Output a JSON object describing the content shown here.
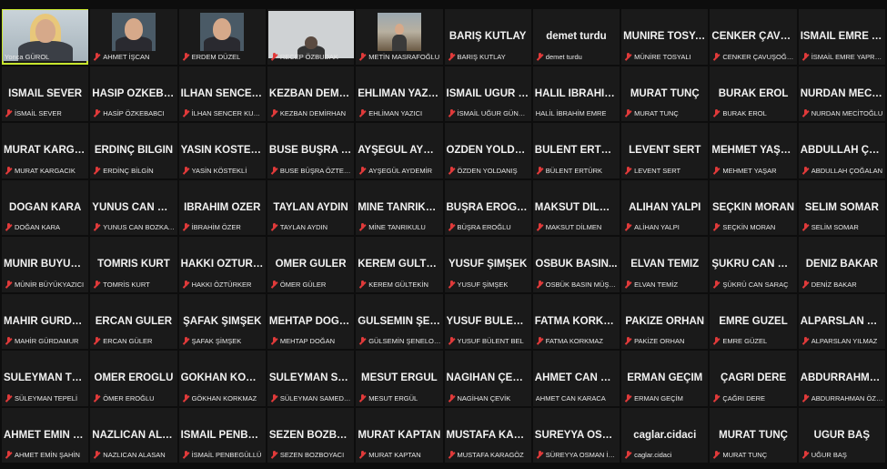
{
  "participants": [
    {
      "big": "",
      "label": "Yonca GÜROL",
      "video": "self",
      "speaking": true,
      "muted": false
    },
    {
      "big": "",
      "label": "AHMET İŞCAN",
      "video": "face",
      "speaking": false,
      "muted": true
    },
    {
      "big": "",
      "label": "ERDEM DÜZEL",
      "video": "face",
      "speaking": false,
      "muted": true
    },
    {
      "big": "",
      "label": "RECEP ÖZBUDAK",
      "video": "wide",
      "speaking": false,
      "muted": true
    },
    {
      "big": "",
      "label": "METİN MASRAFOĞLU",
      "video": "landscape",
      "speaking": false,
      "muted": true
    },
    {
      "big": "BARIŞ KUTLAY",
      "label": "BARIŞ KUTLAY",
      "video": "none",
      "speaking": false,
      "muted": true
    },
    {
      "big": "demet turdu",
      "label": "demet turdu",
      "video": "none",
      "speaking": false,
      "muted": true
    },
    {
      "big": "MÜNİRE TOSYALI",
      "label": "MÜNİRE TOSYALI",
      "video": "none",
      "speaking": false,
      "muted": true
    },
    {
      "big": "CENKER ÇAVUŞ...",
      "label": "CENKER ÇAVUŞOĞLU",
      "video": "none",
      "speaking": false,
      "muted": true
    },
    {
      "big": "İSMAİL EMRE Y...",
      "label": "İSMAİL EMRE YAPRAKCI",
      "video": "none",
      "speaking": false,
      "muted": true
    },
    {
      "big": "İSMAİL SEVER",
      "label": "İSMAİL SEVER",
      "video": "none",
      "speaking": false,
      "muted": true
    },
    {
      "big": "HASİP ÖZKEBA...",
      "label": "HASİP ÖZKEBABCI",
      "video": "none",
      "speaking": false,
      "muted": true
    },
    {
      "big": "İLHAN SENCER...",
      "label": "İLHAN SENCER KURTU...",
      "video": "none",
      "speaking": false,
      "muted": true
    },
    {
      "big": "KEZBAN DEMİR...",
      "label": "KEZBAN DEMİRHAN",
      "video": "none",
      "speaking": false,
      "muted": true
    },
    {
      "big": "EHLİMAN YAZICI",
      "label": "EHLİMAN YAZICI",
      "video": "none",
      "speaking": false,
      "muted": true
    },
    {
      "big": "İSMAİL UĞUR G...",
      "label": "İSMAİL UĞUR GÜNDÜZ",
      "video": "none",
      "speaking": false,
      "muted": true
    },
    {
      "big": "HALİL İBRAHİM...",
      "label": "HALİL İBRAHİM EMRE",
      "video": "none",
      "speaking": false,
      "muted": false
    },
    {
      "big": "MURAT TUNÇ",
      "label": "MURAT TUNÇ",
      "video": "none",
      "speaking": false,
      "muted": true
    },
    {
      "big": "BURAK EROL",
      "label": "BURAK EROL",
      "video": "none",
      "speaking": false,
      "muted": true
    },
    {
      "big": "NURDAN MECİ...",
      "label": "NURDAN MECİTOĞLU",
      "video": "none",
      "speaking": false,
      "muted": true
    },
    {
      "big": "MURAT KARGA...",
      "label": "MURAT KARGACIK",
      "video": "none",
      "speaking": false,
      "muted": true
    },
    {
      "big": "ERDİNÇ BİLGİN",
      "label": "ERDİNÇ BİLGİN",
      "video": "none",
      "speaking": false,
      "muted": true
    },
    {
      "big": "YASİN KÖSTEKLİ",
      "label": "YASİN KÖSTEKLİ",
      "video": "none",
      "speaking": false,
      "muted": true
    },
    {
      "big": "BUSE BÜŞRA Ö...",
      "label": "BUSE BÜŞRA ÖZTEKİN",
      "video": "none",
      "speaking": false,
      "muted": true
    },
    {
      "big": "AYŞEGÜL AYDE...",
      "label": "AYŞEGÜL AYDEMİR",
      "video": "none",
      "speaking": false,
      "muted": true
    },
    {
      "big": "ÖZDEN YOLDA...",
      "label": "ÖZDEN YOLDANIŞ",
      "video": "none",
      "speaking": false,
      "muted": true
    },
    {
      "big": "BÜLENT ERTÜRK",
      "label": "BÜLENT ERTÜRK",
      "video": "none",
      "speaking": false,
      "muted": true
    },
    {
      "big": "LEVENT SERT",
      "label": "LEVENT SERT",
      "video": "none",
      "speaking": false,
      "muted": true
    },
    {
      "big": "MEHMET YAŞAR",
      "label": "MEHMET YAŞAR",
      "video": "none",
      "speaking": false,
      "muted": true
    },
    {
      "big": "ABDULLAH ÇO...",
      "label": "ABDULLAH ÇOĞALAN",
      "video": "none",
      "speaking": false,
      "muted": true
    },
    {
      "big": "DOĞAN KARA",
      "label": "DOĞAN KARA",
      "video": "none",
      "speaking": false,
      "muted": true
    },
    {
      "big": "YUNUS CAN BO...",
      "label": "YUNUS CAN BOZKAYA",
      "video": "none",
      "speaking": false,
      "muted": true
    },
    {
      "big": "İBRAHİM ÖZER",
      "label": "İBRAHİM ÖZER",
      "video": "none",
      "speaking": false,
      "muted": true
    },
    {
      "big": "TAYLAN AYDIN",
      "label": "TAYLAN AYDIN",
      "video": "none",
      "speaking": false,
      "muted": true
    },
    {
      "big": "MİNE TANRIKULU",
      "label": "MİNE TANRIKULU",
      "video": "none",
      "speaking": false,
      "muted": true
    },
    {
      "big": "BÜŞRA EROĞLU",
      "label": "BÜŞRA EROĞLU",
      "video": "none",
      "speaking": false,
      "muted": true
    },
    {
      "big": "MAKSUT DİLMEN",
      "label": "MAKSUT DİLMEN",
      "video": "none",
      "speaking": false,
      "muted": true
    },
    {
      "big": "ALİHAN YALPI",
      "label": "ALİHAN YALPI",
      "video": "none",
      "speaking": false,
      "muted": true
    },
    {
      "big": "SEÇKİN MORAN",
      "label": "SEÇKİN MORAN",
      "video": "none",
      "speaking": false,
      "muted": true
    },
    {
      "big": "SELİM SOMAR",
      "label": "SELİM SOMAR",
      "video": "none",
      "speaking": false,
      "muted": true
    },
    {
      "big": "MÜNİR BÜYÜKY...",
      "label": "MÜNİR BÜYÜKYAZICI",
      "video": "none",
      "speaking": false,
      "muted": true
    },
    {
      "big": "TOMRİS KURT",
      "label": "TOMRİS KURT",
      "video": "none",
      "speaking": false,
      "muted": true
    },
    {
      "big": "HAKKI ÖZTÜRK...",
      "label": "HAKKI ÖZTÜRKER",
      "video": "none",
      "speaking": false,
      "muted": true
    },
    {
      "big": "ÖMER GÜLER",
      "label": "ÖMER GÜLER",
      "video": "none",
      "speaking": false,
      "muted": true
    },
    {
      "big": "KEREM GÜLTEKİN",
      "label": "KEREM GÜLTEKİN",
      "video": "none",
      "speaking": false,
      "muted": true
    },
    {
      "big": "YUSUF ŞİMŞEK",
      "label": "YUSUF ŞİMŞEK",
      "video": "none",
      "speaking": false,
      "muted": true
    },
    {
      "big": "OSBÜK BASIN...",
      "label": "OSBÜK BASIN MÜŞAVİ...",
      "video": "none",
      "speaking": false,
      "muted": true
    },
    {
      "big": "ELVAN TEMİZ",
      "label": "ELVAN TEMİZ",
      "video": "none",
      "speaking": false,
      "muted": true
    },
    {
      "big": "ŞÜKRÜ CAN SA...",
      "label": "ŞÜKRÜ CAN SARAÇ",
      "video": "none",
      "speaking": false,
      "muted": true
    },
    {
      "big": "DENİZ BAKAR",
      "label": "DENİZ BAKAR",
      "video": "none",
      "speaking": false,
      "muted": true
    },
    {
      "big": "MAHİR GÜRDA...",
      "label": "MAHİR GÜRDAMUR",
      "video": "none",
      "speaking": false,
      "muted": true
    },
    {
      "big": "ERCAN GÜLER",
      "label": "ERCAN GÜLER",
      "video": "none",
      "speaking": false,
      "muted": true
    },
    {
      "big": "ŞAFAK ŞİMŞEK",
      "label": "ŞAFAK ŞİMŞEK",
      "video": "none",
      "speaking": false,
      "muted": true
    },
    {
      "big": "MEHTAP DOĞAN",
      "label": "MEHTAP DOĞAN",
      "video": "none",
      "speaking": false,
      "muted": true
    },
    {
      "big": "GÜLSEMİN ŞEN...",
      "label": "GÜLSEMİN ŞENELOĞLU",
      "video": "none",
      "speaking": false,
      "muted": true
    },
    {
      "big": "YUSUF BÜLENT...",
      "label": "YUSUF BÜLENT BEL",
      "video": "none",
      "speaking": false,
      "muted": true
    },
    {
      "big": "FATMA KORKM...",
      "label": "FATMA KORKMAZ",
      "video": "none",
      "speaking": false,
      "muted": true
    },
    {
      "big": "PAKİZE ORHAN",
      "label": "PAKİZE ORHAN",
      "video": "none",
      "speaking": false,
      "muted": true
    },
    {
      "big": "EMRE GÜZEL",
      "label": "EMRE GÜZEL",
      "video": "none",
      "speaking": false,
      "muted": true
    },
    {
      "big": "ALPARSLAN YIL...",
      "label": "ALPARSLAN YILMAZ",
      "video": "none",
      "speaking": false,
      "muted": true
    },
    {
      "big": "SÜLEYMAN TEP...",
      "label": "SÜLEYMAN TEPELİ",
      "video": "none",
      "speaking": false,
      "muted": true
    },
    {
      "big": "ÖMER EROĞLU",
      "label": "ÖMER EROĞLU",
      "video": "none",
      "speaking": false,
      "muted": true
    },
    {
      "big": "GÖKHAN KORK...",
      "label": "GÖKHAN KORKMAZ",
      "video": "none",
      "speaking": false,
      "muted": true
    },
    {
      "big": "SÜLEYMAN SA...",
      "label": "SÜLEYMAN SAMED U...",
      "video": "none",
      "speaking": false,
      "muted": true
    },
    {
      "big": "MESUT ERGÜL",
      "label": "MESUT ERGÜL",
      "video": "none",
      "speaking": false,
      "muted": true
    },
    {
      "big": "NAGİHAN ÇEVİK",
      "label": "NAGİHAN ÇEVİK",
      "video": "none",
      "speaking": false,
      "muted": true
    },
    {
      "big": "AHMET CAN KA...",
      "label": "AHMET CAN KARACA",
      "video": "none",
      "speaking": false,
      "muted": false
    },
    {
      "big": "ERMAN GEÇİM",
      "label": "ERMAN GEÇİM",
      "video": "none",
      "speaking": false,
      "muted": true
    },
    {
      "big": "ÇAĞRI DERE",
      "label": "ÇAĞRI DERE",
      "video": "none",
      "speaking": false,
      "muted": true
    },
    {
      "big": "ABDURRAHMA...",
      "label": "ABDURRAHMAN ÖZK...",
      "video": "none",
      "speaking": false,
      "muted": true
    },
    {
      "big": "AHMET EMİN Ş...",
      "label": "AHMET EMİN ŞAHİN",
      "video": "none",
      "speaking": false,
      "muted": true
    },
    {
      "big": "NAZLICAN ALA...",
      "label": "NAZLICAN ALASAN",
      "video": "none",
      "speaking": false,
      "muted": true
    },
    {
      "big": "İSMAİL PENBEG...",
      "label": "İSMAİL PENBEGÜLLÜ",
      "video": "none",
      "speaking": false,
      "muted": true
    },
    {
      "big": "SEZEN BOZBOY...",
      "label": "SEZEN BOZBOYACI",
      "video": "none",
      "speaking": false,
      "muted": true
    },
    {
      "big": "MURAT KAPTAN",
      "label": "MURAT KAPTAN",
      "video": "none",
      "speaking": false,
      "muted": true
    },
    {
      "big": "MUSTAFA KARA...",
      "label": "MUSTAFA KARAGÖZ",
      "video": "none",
      "speaking": false,
      "muted": true
    },
    {
      "big": "SÜREYYA OSMA...",
      "label": "SÜREYYA OSMAN İNA...",
      "video": "none",
      "speaking": false,
      "muted": true
    },
    {
      "big": "caglar.cidaci",
      "label": "caglar.cidaci",
      "video": "none",
      "speaking": false,
      "muted": true
    },
    {
      "big": "MURAT TUNÇ",
      "label": "MURAT TUNÇ",
      "video": "none",
      "speaking": false,
      "muted": true
    },
    {
      "big": "UĞUR BAŞ",
      "label": "UĞUR BAŞ",
      "video": "none",
      "speaking": false,
      "muted": true
    }
  ],
  "colors": {
    "tile_bg": "#1a1a1a",
    "active_speaker_border": "#c8e62e",
    "muted_icon": "#e03a3a"
  }
}
